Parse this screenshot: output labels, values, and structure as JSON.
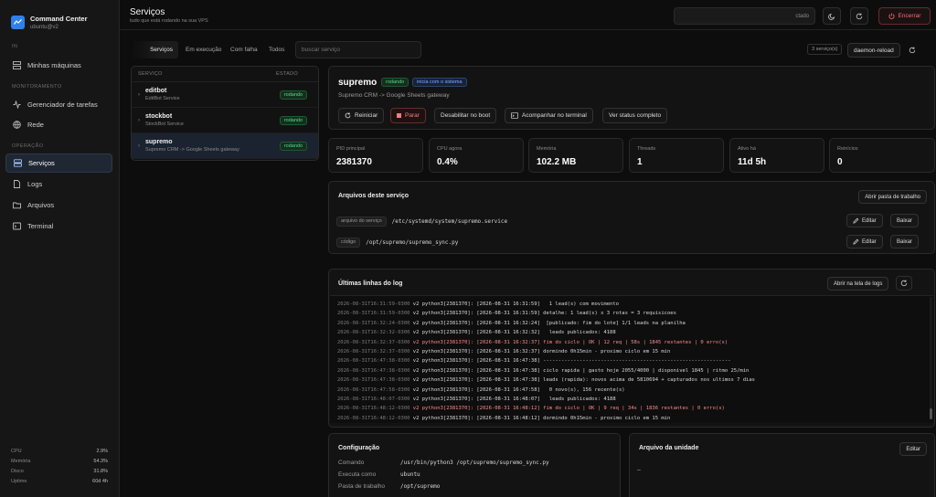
{
  "brand": {
    "title": "Command Center",
    "subtitle": "ubuntu@v2"
  },
  "sidebar": {
    "sections": [
      "IN",
      "MONITORAMENTO",
      "OPERAÇÃO"
    ],
    "items": [
      {
        "label": "Minhas máquinas",
        "icon": "grid-icon"
      },
      {
        "label": "Gerenciador de tarefas",
        "icon": "activity-icon"
      },
      {
        "label": "Rede",
        "icon": "globe-icon"
      },
      {
        "label": "Serviços",
        "icon": "server-icon"
      },
      {
        "label": "Logs",
        "icon": "document-icon"
      },
      {
        "label": "Arquivos",
        "icon": "folder-icon"
      },
      {
        "label": "Terminal",
        "icon": "terminal-icon"
      }
    ],
    "stats": [
      {
        "label": "CPU",
        "value": "2.9%"
      },
      {
        "label": "Memória",
        "value": "54.3%"
      },
      {
        "label": "Disco",
        "value": "31.8%"
      },
      {
        "label": "Uptime",
        "value": "60d 4h"
      }
    ]
  },
  "header": {
    "title": "Serviços",
    "subtitle": "tudo que está rodando na sua VPS",
    "search_text": "ctado",
    "end_label": "Encerrar"
  },
  "filters": {
    "tabs": [
      "Serviços",
      "Em execução",
      "Com falha",
      "Todos"
    ],
    "search_placeholder": "buscar serviço",
    "count": "3 serviço(s)",
    "daemon_reload": "daemon-reload"
  },
  "services": {
    "columns": [
      "SERVIÇO",
      "ESTADO"
    ],
    "rows": [
      {
        "name": "editbot",
        "desc": "EditBot Service",
        "state": "rodando"
      },
      {
        "name": "stockbot",
        "desc": "StockBot Service",
        "state": "rodando"
      },
      {
        "name": "supremo",
        "desc": "Supremo CRM -> Google Sheets gateway",
        "state": "rodando"
      }
    ]
  },
  "detail": {
    "name": "supremo",
    "badge_state": "rodando",
    "badge_boot": "inicia com o sistema",
    "description": "Supremo CRM -> Google Sheets gateway",
    "actions": [
      "Reiniciar",
      "Parar",
      "Desabilitar no boot",
      "Acompanhar no terminal",
      "Ver status completo"
    ]
  },
  "metrics": [
    {
      "label": "PID principal",
      "value": "2381370"
    },
    {
      "label": "CPU agora",
      "value": "0.4%"
    },
    {
      "label": "Memória",
      "value": "102.2 MB"
    },
    {
      "label": "Threads",
      "value": "1"
    },
    {
      "label": "Ativo há",
      "value": "11d 5h"
    },
    {
      "label": "Reinícios",
      "value": "0"
    }
  ],
  "files": {
    "title": "Arquivos deste serviço",
    "open_folder": "Abrir pasta de trabalho",
    "rows": [
      {
        "tag": "arquivo do serviço",
        "path": "/etc/systemd/system/supremo.service",
        "edit": "Editar",
        "download": "Baixar"
      },
      {
        "tag": "código",
        "path": "/opt/supremo/supremo_sync.py",
        "edit": "Editar",
        "download": "Baixar"
      }
    ]
  },
  "log": {
    "title": "Últimas linhas do log",
    "open_logs": "Abrir na tela de logs",
    "lines": [
      {
        "ts": "2026-08-31T16:31:59-0300",
        "msg": " v2 python3[2381370]: [2026-08-31 16:31:59]   1 lead(s) com movimento",
        "hl": false
      },
      {
        "ts": "2026-08-31T16:31:59-0300",
        "msg": " v2 python3[2381370]: [2026-08-31 16:31:59] detalhe: 1 lead(s) x 3 rotas = 3 requisicoes",
        "hl": false
      },
      {
        "ts": "2026-08-31T16:32:24-0300",
        "msg": " v2 python3[2381370]: [2026-08-31 16:32:24]  [publicado: fim do lote] 1/1 leads na planilha",
        "hl": false
      },
      {
        "ts": "2026-08-31T16:32:32-0300",
        "msg": " v2 python3[2381370]: [2026-08-31 16:32:32]   leads publicados: 4188",
        "hl": false
      },
      {
        "ts": "2026-08-31T16:32:37-0300",
        "msg": " v2 python3[2381370]: [2026-08-31 16:32:37] fim do ciclo | OK | 12 req | 58s | 1845 restantes | 0 erro(s)",
        "hl": true
      },
      {
        "ts": "2026-08-31T16:32:37-0300",
        "msg": " v2 python3[2381370]: [2026-08-31 16:32:37] dormindo 0h15min - proximo ciclo em 15 min",
        "hl": false
      },
      {
        "ts": "2026-08-31T16:47:38-0300",
        "msg": " v2 python3[2381370]: [2026-08-31 16:47:38] --------------------------------------------------------------",
        "hl": false
      },
      {
        "ts": "2026-08-31T16:47:38-0300",
        "msg": " v2 python3[2381370]: [2026-08-31 16:47:38] ciclo rapida | gasto hoje 2055/4000 | disponivel 1845 | ritmo 25/min",
        "hl": false
      },
      {
        "ts": "2026-08-31T16:47:38-0300",
        "msg": " v2 python3[2381370]: [2026-08-31 16:47:38] leads (rapida): novos acima de 5810694 + capturados nos ultimos 7 dias",
        "hl": false
      },
      {
        "ts": "2026-08-31T16:47:58-0300",
        "msg": " v2 python3[2381370]: [2026-08-31 16:47:58]   0 novo(s), 156 recente(s)",
        "hl": false
      },
      {
        "ts": "2026-08-31T16:48:07-0300",
        "msg": " v2 python3[2381370]: [2026-08-31 16:48:07]   leads publicados: 4188",
        "hl": false
      },
      {
        "ts": "2026-08-31T16:48:12-0300",
        "msg": " v2 python3[2381370]: [2026-08-31 16:48:12] fim do ciclo | OK | 9 req | 34s | 1836 restantes | 0 erro(s)",
        "hl": true
      },
      {
        "ts": "2026-08-31T16:48:12-0300",
        "msg": " v2 python3[2381370]: [2026-08-31 16:48:12] dormindo 0h15min - proximo ciclo em 15 min",
        "hl": false
      }
    ]
  },
  "config": {
    "title": "Configuração",
    "rows": [
      {
        "k": "Comando",
        "v": "/usr/bin/python3 /opt/supremo/supremo_sync.py"
      },
      {
        "k": "Executa como",
        "v": "ubuntu"
      },
      {
        "k": "Pasta de trabalho",
        "v": "/opt/supremo"
      }
    ]
  },
  "unit_file": {
    "title": "Arquivo da unidade",
    "edit": "Editar",
    "content": "–"
  }
}
